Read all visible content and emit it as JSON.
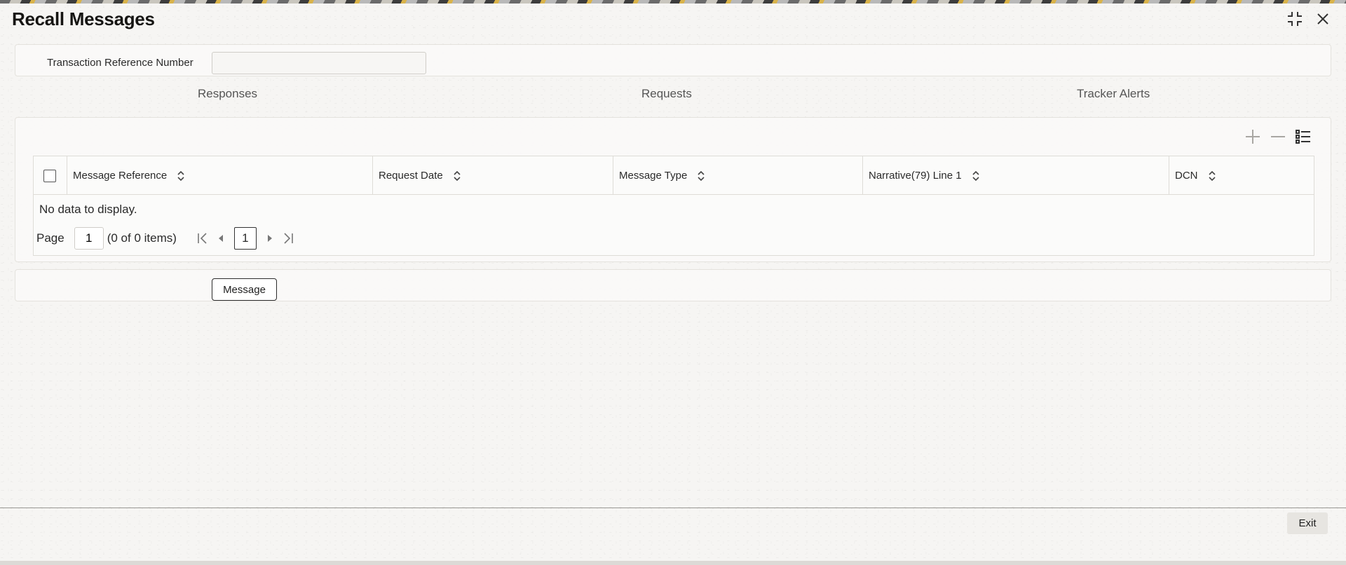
{
  "window": {
    "title": "Recall Messages"
  },
  "form": {
    "transaction_reference_label": "Transaction Reference Number",
    "transaction_reference_value": ""
  },
  "tabs": [
    {
      "label": "Responses"
    },
    {
      "label": "Requests"
    },
    {
      "label": "Tracker Alerts"
    }
  ],
  "grid": {
    "columns": [
      {
        "label": "Message Reference"
      },
      {
        "label": "Request Date"
      },
      {
        "label": "Message Type"
      },
      {
        "label": "Narrative(79) Line 1"
      },
      {
        "label": "DCN"
      }
    ],
    "empty_text": "No data to display.",
    "pager": {
      "page_label": "Page",
      "page_value": "1",
      "items_text": "(0 of 0 items)",
      "current_page": "1"
    }
  },
  "actions": {
    "message_label": "Message",
    "exit_label": "Exit"
  },
  "icons": {
    "maximize": "maximize-icon",
    "close": "close-icon",
    "add": "plus-icon",
    "remove": "minus-icon",
    "view": "list-icon",
    "sort": "sort-icon",
    "first": "first-page-icon",
    "prev": "prev-page-icon",
    "next": "next-page-icon",
    "last": "last-page-icon"
  }
}
